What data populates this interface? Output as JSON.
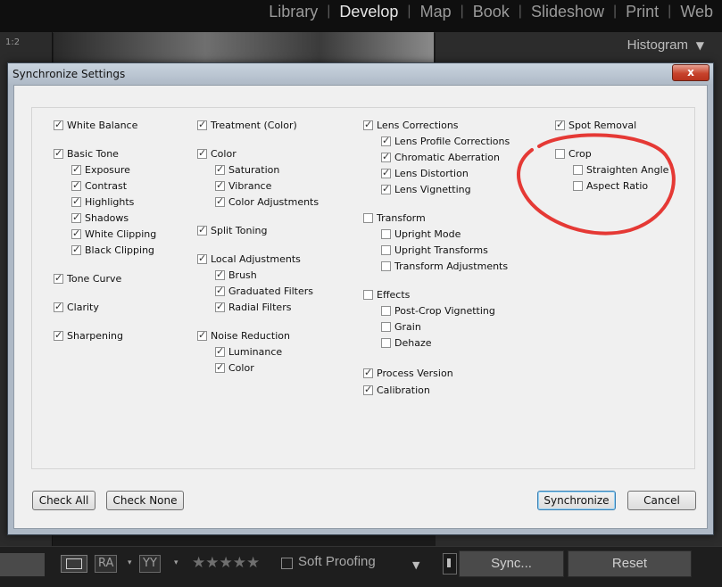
{
  "modules": [
    "Library",
    "Develop",
    "Map",
    "Book",
    "Slideshow",
    "Print",
    "Web"
  ],
  "active_module": "Develop",
  "zoom_label": "1:2",
  "histogram_label": "Histogram",
  "bottom_bar": {
    "ra_label": "RA",
    "yy_label": "YY",
    "stars": "★★★★★",
    "soft_proofing": "Soft Proofing",
    "sync_label": "Sync...",
    "reset_label": "Reset"
  },
  "dialog": {
    "title": "Synchronize Settings",
    "close_glyph": "x",
    "check_all": "Check All",
    "check_none": "Check None",
    "synchronize": "Synchronize",
    "cancel": "Cancel"
  },
  "checkboxes": [
    {
      "label": "White Balance",
      "checked": true,
      "col": 0,
      "x": 0,
      "y": 0
    },
    {
      "label": "Basic Tone",
      "checked": true,
      "col": 0,
      "x": 0,
      "y": 1
    },
    {
      "label": "Exposure",
      "checked": true,
      "col": 0,
      "x": 1,
      "y": 2
    },
    {
      "label": "Contrast",
      "checked": true,
      "col": 0,
      "x": 1,
      "y": 3
    },
    {
      "label": "Highlights",
      "checked": true,
      "col": 0,
      "x": 1,
      "y": 4
    },
    {
      "label": "Shadows",
      "checked": true,
      "col": 0,
      "x": 1,
      "y": 5
    },
    {
      "label": "White Clipping",
      "checked": true,
      "col": 0,
      "x": 1,
      "y": 6
    },
    {
      "label": "Black Clipping",
      "checked": true,
      "col": 0,
      "x": 1,
      "y": 7
    },
    {
      "label": "Tone Curve",
      "checked": true,
      "col": 0,
      "x": 0,
      "y": 8
    },
    {
      "label": "Clarity",
      "checked": true,
      "col": 0,
      "x": 0,
      "y": 9
    },
    {
      "label": "Sharpening",
      "checked": true,
      "col": 0,
      "x": 0,
      "y": 10
    },
    {
      "label": "Treatment (Color)",
      "checked": true,
      "col": 1,
      "x": 0,
      "y": 0
    },
    {
      "label": "Color",
      "checked": true,
      "col": 1,
      "x": 0,
      "y": 1
    },
    {
      "label": "Saturation",
      "checked": true,
      "col": 1,
      "x": 1,
      "y": 2
    },
    {
      "label": "Vibrance",
      "checked": true,
      "col": 1,
      "x": 1,
      "y": 3
    },
    {
      "label": "Color Adjustments",
      "checked": true,
      "col": 1,
      "x": 1,
      "y": 4
    },
    {
      "label": "Split Toning",
      "checked": true,
      "col": 1,
      "x": 0,
      "y": 5
    },
    {
      "label": "Local Adjustments",
      "checked": true,
      "col": 1,
      "x": 0,
      "y": 6
    },
    {
      "label": "Brush",
      "checked": true,
      "col": 1,
      "x": 1,
      "y": 7
    },
    {
      "label": "Graduated Filters",
      "checked": true,
      "col": 1,
      "x": 1,
      "y": 8
    },
    {
      "label": "Radial Filters",
      "checked": true,
      "col": 1,
      "x": 1,
      "y": 9
    },
    {
      "label": "Noise Reduction",
      "checked": true,
      "col": 1,
      "x": 0,
      "y": 10
    },
    {
      "label": "Luminance",
      "checked": true,
      "col": 1,
      "x": 1,
      "y": 11
    },
    {
      "label": "Color",
      "checked": true,
      "col": 1,
      "x": 1,
      "y": 12
    },
    {
      "label": "Lens Corrections",
      "checked": true,
      "col": 2,
      "x": 0,
      "y": 0
    },
    {
      "label": "Lens Profile Corrections",
      "checked": true,
      "col": 2,
      "x": 1,
      "y": 1
    },
    {
      "label": "Chromatic Aberration",
      "checked": true,
      "col": 2,
      "x": 1,
      "y": 2
    },
    {
      "label": "Lens Distortion",
      "checked": true,
      "col": 2,
      "x": 1,
      "y": 3
    },
    {
      "label": "Lens Vignetting",
      "checked": true,
      "col": 2,
      "x": 1,
      "y": 4
    },
    {
      "label": "Transform",
      "checked": false,
      "col": 2,
      "x": 0,
      "y": 5
    },
    {
      "label": "Upright Mode",
      "checked": false,
      "col": 2,
      "x": 1,
      "y": 6
    },
    {
      "label": "Upright Transforms",
      "checked": false,
      "col": 2,
      "x": 1,
      "y": 7
    },
    {
      "label": "Transform Adjustments",
      "checked": false,
      "col": 2,
      "x": 1,
      "y": 8
    },
    {
      "label": "Effects",
      "checked": false,
      "col": 2,
      "x": 0,
      "y": 9
    },
    {
      "label": "Post-Crop Vignetting",
      "checked": false,
      "col": 2,
      "x": 1,
      "y": 10
    },
    {
      "label": "Grain",
      "checked": false,
      "col": 2,
      "x": 1,
      "y": 11
    },
    {
      "label": "Dehaze",
      "checked": false,
      "col": 2,
      "x": 1,
      "y": 12
    },
    {
      "label": "Process Version",
      "checked": true,
      "col": 2,
      "x": 0,
      "y": 13
    },
    {
      "label": "Calibration",
      "checked": true,
      "col": 2,
      "x": 0,
      "y": 14
    },
    {
      "label": "Spot Removal",
      "checked": true,
      "col": 3,
      "x": 0,
      "y": 0
    },
    {
      "label": "Crop",
      "checked": false,
      "col": 3,
      "x": 0,
      "y": 1
    },
    {
      "label": "Straighten Angle",
      "checked": false,
      "col": 3,
      "x": 1,
      "y": 2
    },
    {
      "label": "Aspect Ratio",
      "checked": false,
      "col": 3,
      "x": 1,
      "y": 3
    }
  ],
  "colors": {
    "annotation": "#e53935",
    "dialog_frame": "#aeb9c6",
    "close_red": "#c7432c"
  }
}
